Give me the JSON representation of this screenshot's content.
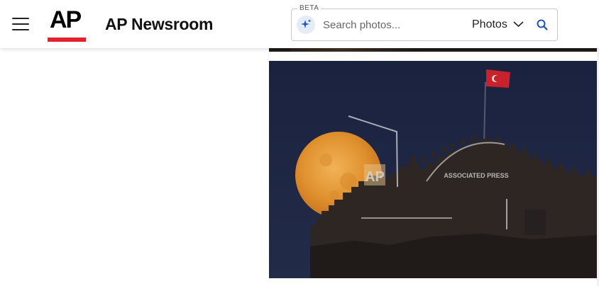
{
  "header": {
    "logo_text": "AP",
    "title": "AP Newsroom",
    "menu_icon": "hamburger-menu-icon"
  },
  "search": {
    "beta_label": "BETA",
    "placeholder": "Search photos...",
    "filter_value": "Photos",
    "ai_icon": "sparkle-icon",
    "submit_icon": "search-icon"
  },
  "photo": {
    "watermark_logo": "AP",
    "watermark_text": "ASSOCIATED PRESS",
    "alt": "Full moon rising behind a castle wall with a Turkish flag"
  },
  "colors": {
    "brand_red": "#e4202c",
    "accent_blue": "#1a56b0",
    "sky": "#1b2440",
    "moon": "#e79a3a"
  }
}
